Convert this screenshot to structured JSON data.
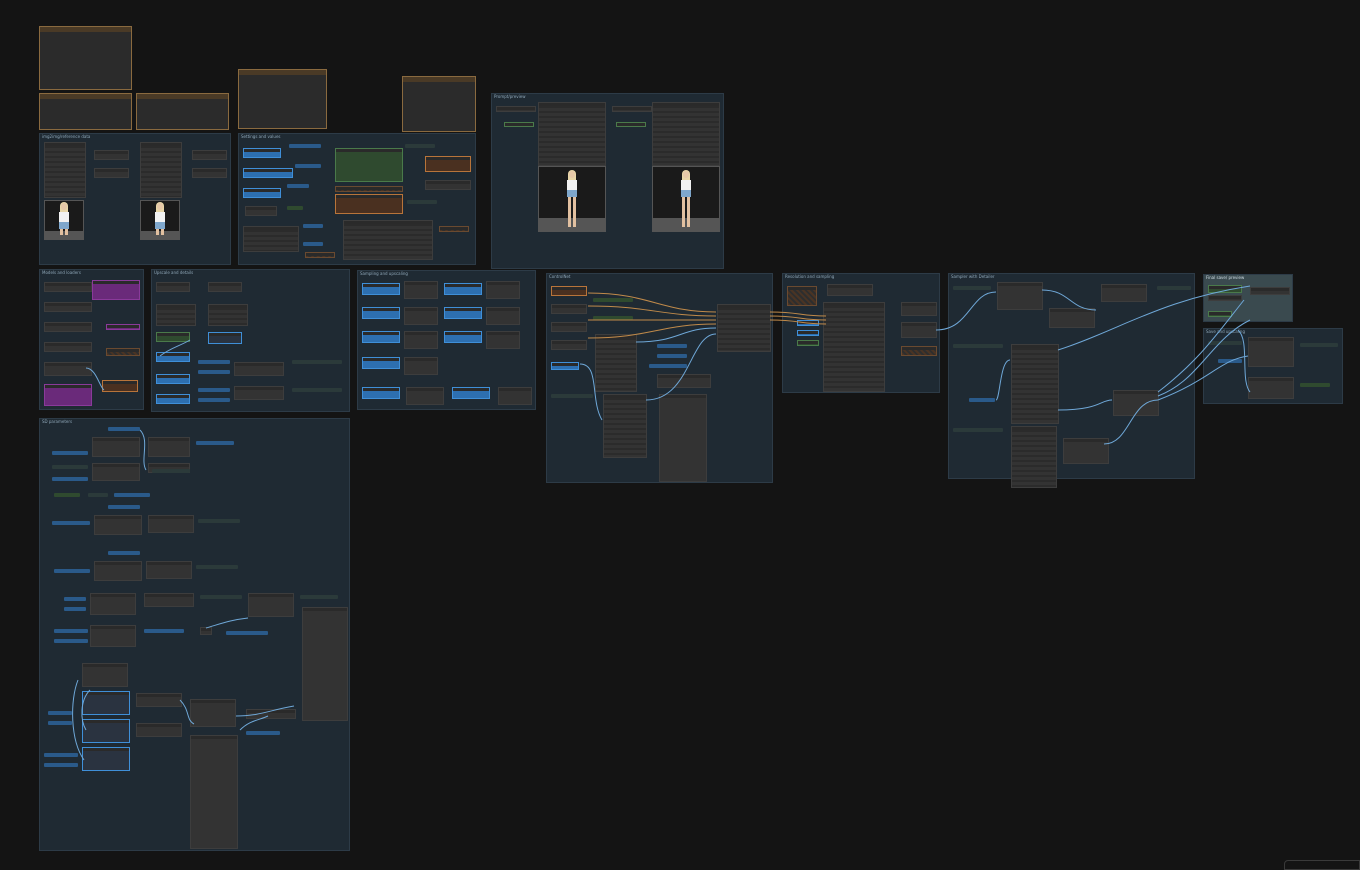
{
  "groups": {
    "prompt_preview": "Prompt/preview",
    "img2img": "img2img/reference data",
    "settings": "Settings and values",
    "upscale": "Upscale and details",
    "sampling": "Sampling and upscaling",
    "resolution": "Resolution and sampling",
    "models": "Models and loaders",
    "controlnet": "ControlNet",
    "sampler": "Sampler with Detailer",
    "save": "Save and upscaling",
    "final_save": "Final save/ preview",
    "sd_params": "SD parameters"
  },
  "corner_tab": ""
}
